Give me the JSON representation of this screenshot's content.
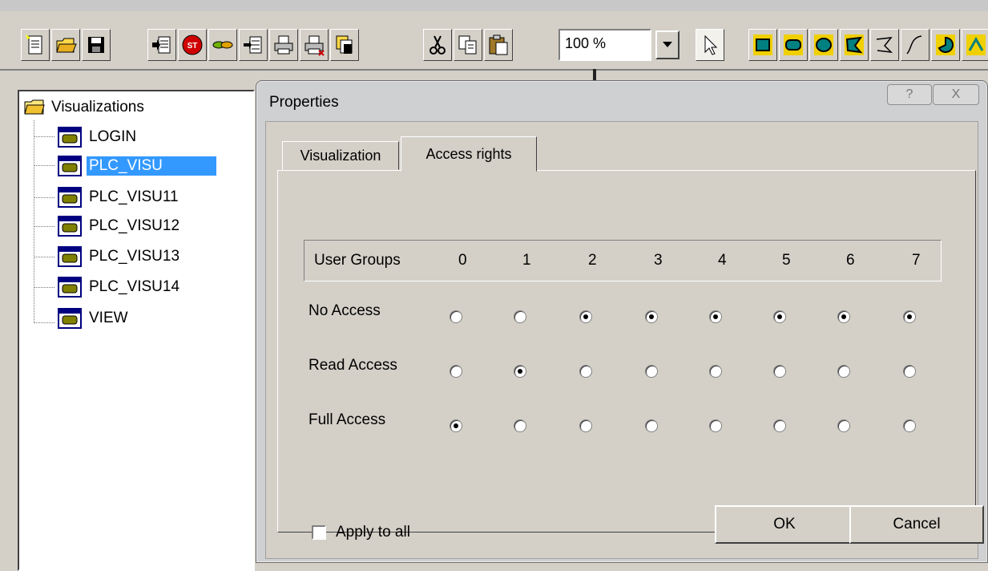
{
  "toolbar": {
    "zoom_value": "100 %",
    "buttons": [
      "new-icon",
      "open-icon",
      "save-icon",
      "import-icon",
      "stop-icon",
      "link-icon",
      "insert-icon",
      "print-icon",
      "print-setup-icon",
      "catalog-icon",
      "cut-icon",
      "copy-icon",
      "paste-icon",
      "pointer-icon",
      "rectangle-icon",
      "rounded-rect-icon",
      "ellipse-icon",
      "polygon-icon",
      "polyline-icon",
      "curve-icon",
      "pie-icon"
    ]
  },
  "tree": {
    "root_label": "Visualizations",
    "items": [
      {
        "label": "LOGIN",
        "selected": false
      },
      {
        "label": "PLC_VISU",
        "selected": true
      },
      {
        "label": "PLC_VISU11",
        "selected": false
      },
      {
        "label": "PLC_VISU12",
        "selected": false
      },
      {
        "label": "PLC_VISU13",
        "selected": false
      },
      {
        "label": "PLC_VISU14",
        "selected": false
      },
      {
        "label": "VIEW",
        "selected": false
      }
    ]
  },
  "dialog": {
    "title": "Properties",
    "help_label": "?",
    "close_label": "X",
    "tabs": [
      {
        "label": "Visualization",
        "active": false
      },
      {
        "label": "Access rights",
        "active": true
      }
    ],
    "header_label": "User Groups",
    "groups": [
      "0",
      "1",
      "2",
      "3",
      "4",
      "5",
      "6",
      "7"
    ],
    "rows": [
      {
        "label": "No Access",
        "values": [
          false,
          false,
          true,
          true,
          true,
          true,
          true,
          true
        ]
      },
      {
        "label": "Read Access",
        "values": [
          false,
          true,
          false,
          false,
          false,
          false,
          false,
          false
        ]
      },
      {
        "label": "Full Access",
        "values": [
          true,
          false,
          false,
          false,
          false,
          false,
          false,
          false
        ]
      }
    ],
    "apply_all_label": "Apply to all",
    "apply_all_checked": false,
    "ok_label": "OK",
    "cancel_label": "Cancel"
  }
}
